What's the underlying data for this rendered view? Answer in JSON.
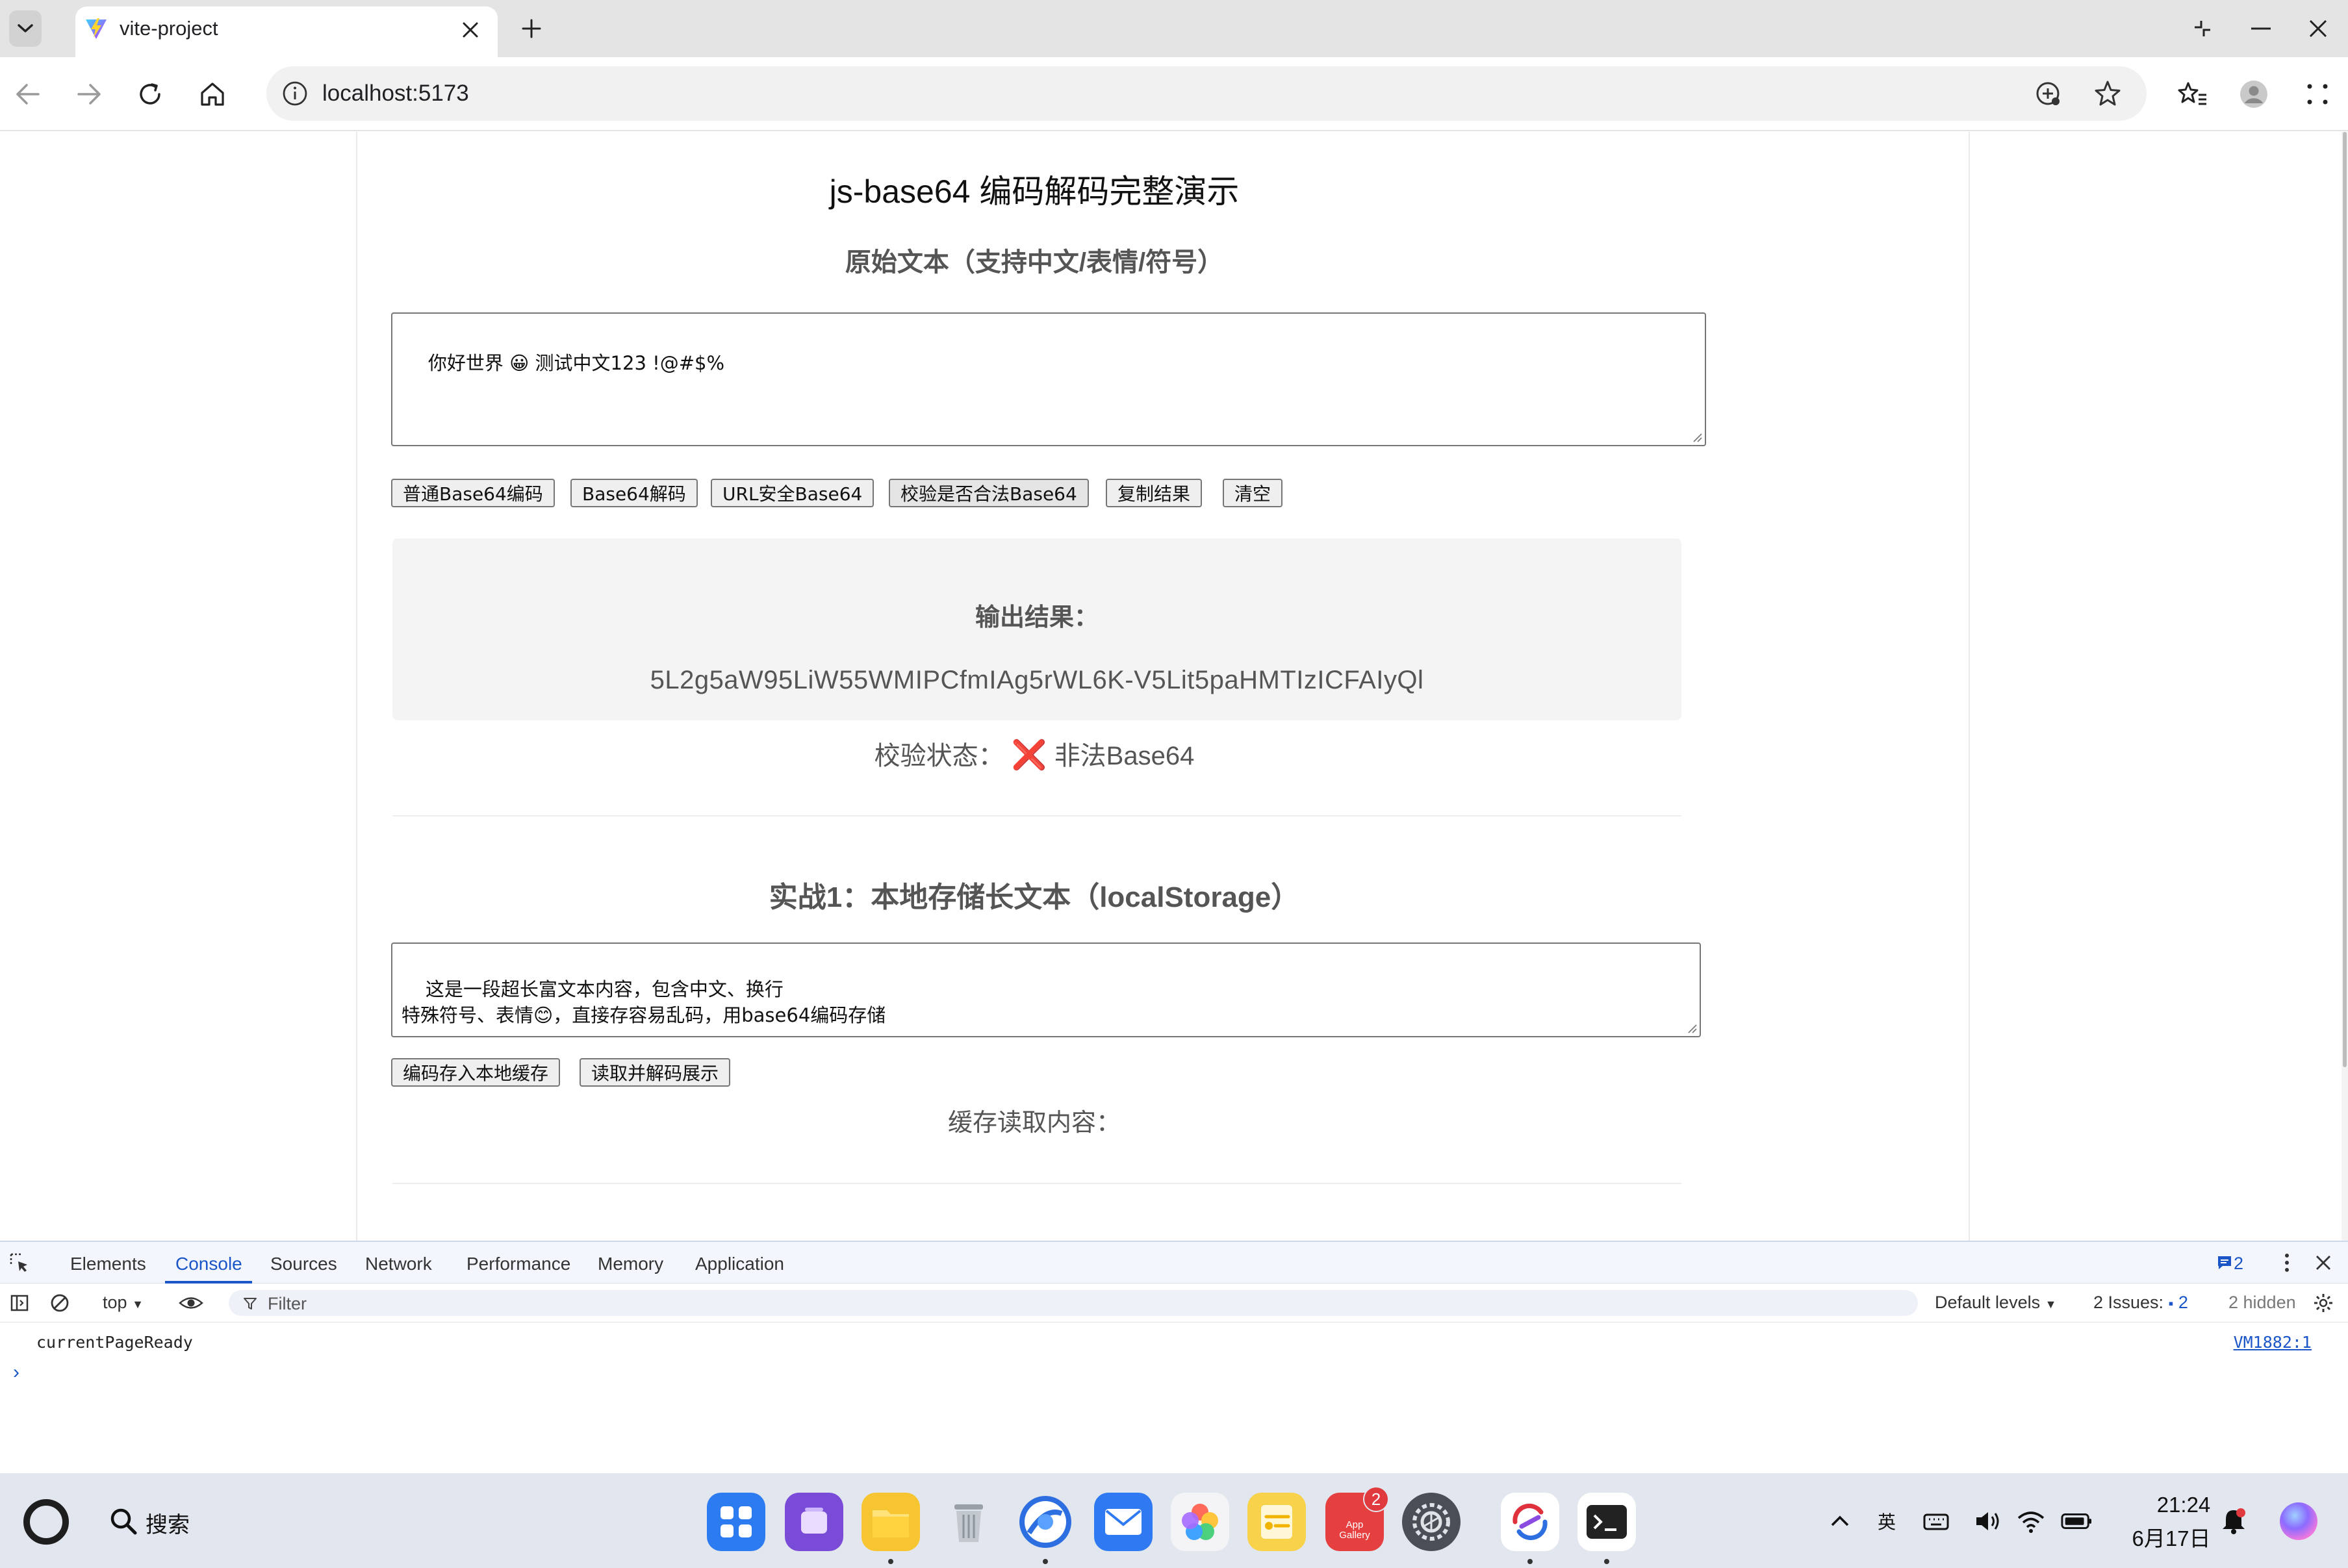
{
  "browser": {
    "tab_title": "vite-project",
    "url": "localhost:5173"
  },
  "page": {
    "title": "js-base64 编码解码完整演示",
    "original_heading": "原始文本（支持中文/表情/符号）",
    "original_text": "你好世界 😀 测试中文123 !@#$%",
    "buttons": [
      "普通Base64编码",
      "Base64解码",
      "URL安全Base64",
      "校验是否合法Base64",
      "复制结果",
      "清空"
    ],
    "result_label": "输出结果：",
    "result_value": "5L2g5aW95LiW55WMIPCfmIAg5rWL6K-V5Lit5paHMTIzICFAIyQl",
    "status_label": "校验状态：",
    "status_icon": "❌",
    "status_value": "非法Base64",
    "section2_heading": "实战1：本地存储长文本（localStorage）",
    "long_text": "这是一段超长富文本内容，包含中文、换行\n特殊符号、表情😊，直接存容易乱码，用base64编码存储",
    "storage_buttons": [
      "编码存入本地缓存",
      "读取并解码展示"
    ],
    "cache_label": "缓存读取内容："
  },
  "devtools": {
    "tabs": [
      "Elements",
      "Console",
      "Sources",
      "Network",
      "Performance",
      "Memory",
      "Application"
    ],
    "active_tab": "Console",
    "message_count": "2",
    "context": "top",
    "filter_placeholder": "Filter",
    "levels": "Default levels",
    "issues_label": "2 Issues:",
    "issues_count": "2",
    "hidden": "2 hidden",
    "console_message": "currentPageReady",
    "console_source": "VM1882:1",
    "prompt": "›"
  },
  "taskbar": {
    "search_label": "搜索",
    "app_gallery_label": "App\nGallery",
    "app_gallery_badge": "2",
    "ime": "英",
    "time": "21:24",
    "date": "6月17日"
  },
  "colors": {
    "tab_strip": "#e4e4e4",
    "accent": "#1a56c8",
    "error": "#d6303f",
    "result_bg": "#f4f4f4",
    "taskbar": "#e2e6ee"
  }
}
